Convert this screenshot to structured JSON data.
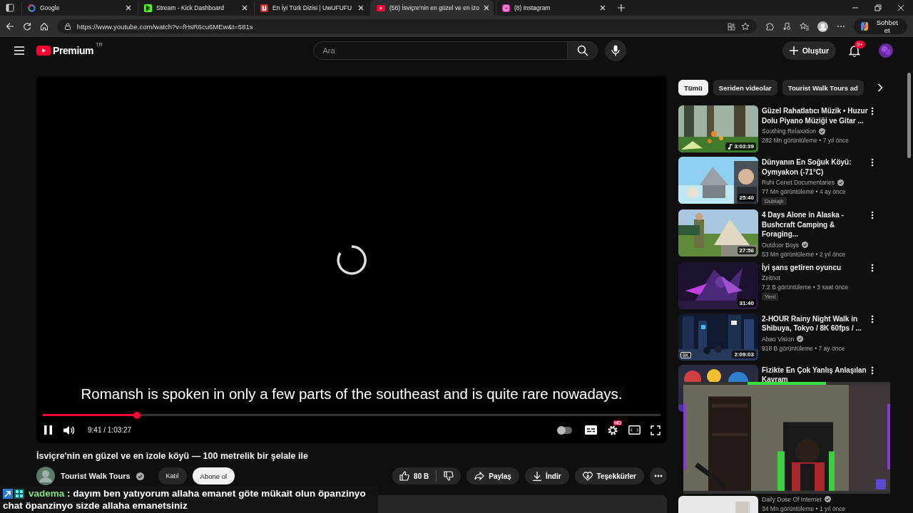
{
  "browser": {
    "tabs": [
      {
        "title": "Google",
        "selected": false
      },
      {
        "title": "Stream - Kick Dashboard",
        "selected": false
      },
      {
        "title": "En İyi Türk Dizisi | UwUFUFU",
        "selected": false
      },
      {
        "title": "(56) İsviçre'nin en güzel ve en izo",
        "selected": true
      },
      {
        "title": "(8) Instagram",
        "selected": false
      }
    ],
    "url": "https://www.youtube.com/watch?v=fHsR6cu6MEw&t=581s",
    "chat_button": "Sohbet et"
  },
  "header": {
    "logo": "Premium",
    "region": "TR",
    "search": {
      "placeholder": "Ara"
    },
    "create_button": "Oluştur",
    "notification_badge": "9+"
  },
  "player": {
    "subtitle": "Romansh is spoken in only a few parts of the southeast and is quite rare nowadays.",
    "progress": {
      "level": 0.152
    },
    "playing": true,
    "time": "9:41 / 1:03:27",
    "autoplay": false,
    "settings_badge": "HD"
  },
  "video": {
    "title": "İsviçre'nin en güzel ve en izole köyü — 100 metrelik bir şelale ile",
    "channel": "Tourist Walk Tours",
    "verified": true,
    "join_button": "Katıl",
    "subscribe_button": "Abone ol",
    "likes": "80 B",
    "share_button": "Paylaş",
    "download_button": "İndir",
    "thanks_button": "Teşekkürler"
  },
  "chips": [
    {
      "label": "Tümü",
      "selected": true
    },
    {
      "label": "Seriden videolar",
      "selected": false
    },
    {
      "label": "Tourist Walk Tours ad",
      "selected": false
    }
  ],
  "recommendations": [
    {
      "title": "Güzel Rahatlatıcı Müzik • Huzur Dolu Piyano Müziği ve Gitar ...",
      "channel": "Soothing Relaxation",
      "verified": true,
      "stats": "282 Mn görüntüleme • 7 yıl önce",
      "duration": "3:03:39",
      "audio": true
    },
    {
      "title": "Dünyanın En Soğuk Köyü: Oymyakon (-71°C)",
      "channel": "Ruhi Cenet Documentaries",
      "verified": true,
      "stats": "77 Mn görüntüleme • 4 ay önce",
      "duration": "25:40",
      "badge": "Dublajlı"
    },
    {
      "title": "4 Days Alone in Alaska - Bushcraft Camping & Foraging...",
      "channel": "Outdoor Boys",
      "verified": true,
      "stats": "53 Mn görüntüleme • 2 yıl önce",
      "duration": "27:56"
    },
    {
      "title": "İyi şans getiren oyuncu",
      "channel": "Zeitnot",
      "stats": "7,2 B görüntüleme • 3 saat önce",
      "duration": "31:40",
      "badge": "Yeni"
    },
    {
      "title": "2-HOUR Rainy Night Walk in Shibuya, Tokyo / 8K 60fps / ...",
      "channel": "Abao Vision",
      "verified": true,
      "stats": "918 B görüntüleme • 7 ay önce",
      "duration": "2:09:03",
      "quality": "8K"
    },
    {
      "title": "Fizikte En Çok Yanlış Anlaşılan Kavram"
    },
    {
      "channel": "Daily Dose Of Internet",
      "verified": true,
      "stats": "34 Mn görüntüleme • 1 yıl önce"
    }
  ],
  "chat_overlay": {
    "username": "vadema",
    "lines": [
      ": dayım ben yatıyorum allaha emanet göte mükait olun öpanzinyo",
      "chat öpanzinyo sizde allaha emanetsiniz"
    ]
  }
}
